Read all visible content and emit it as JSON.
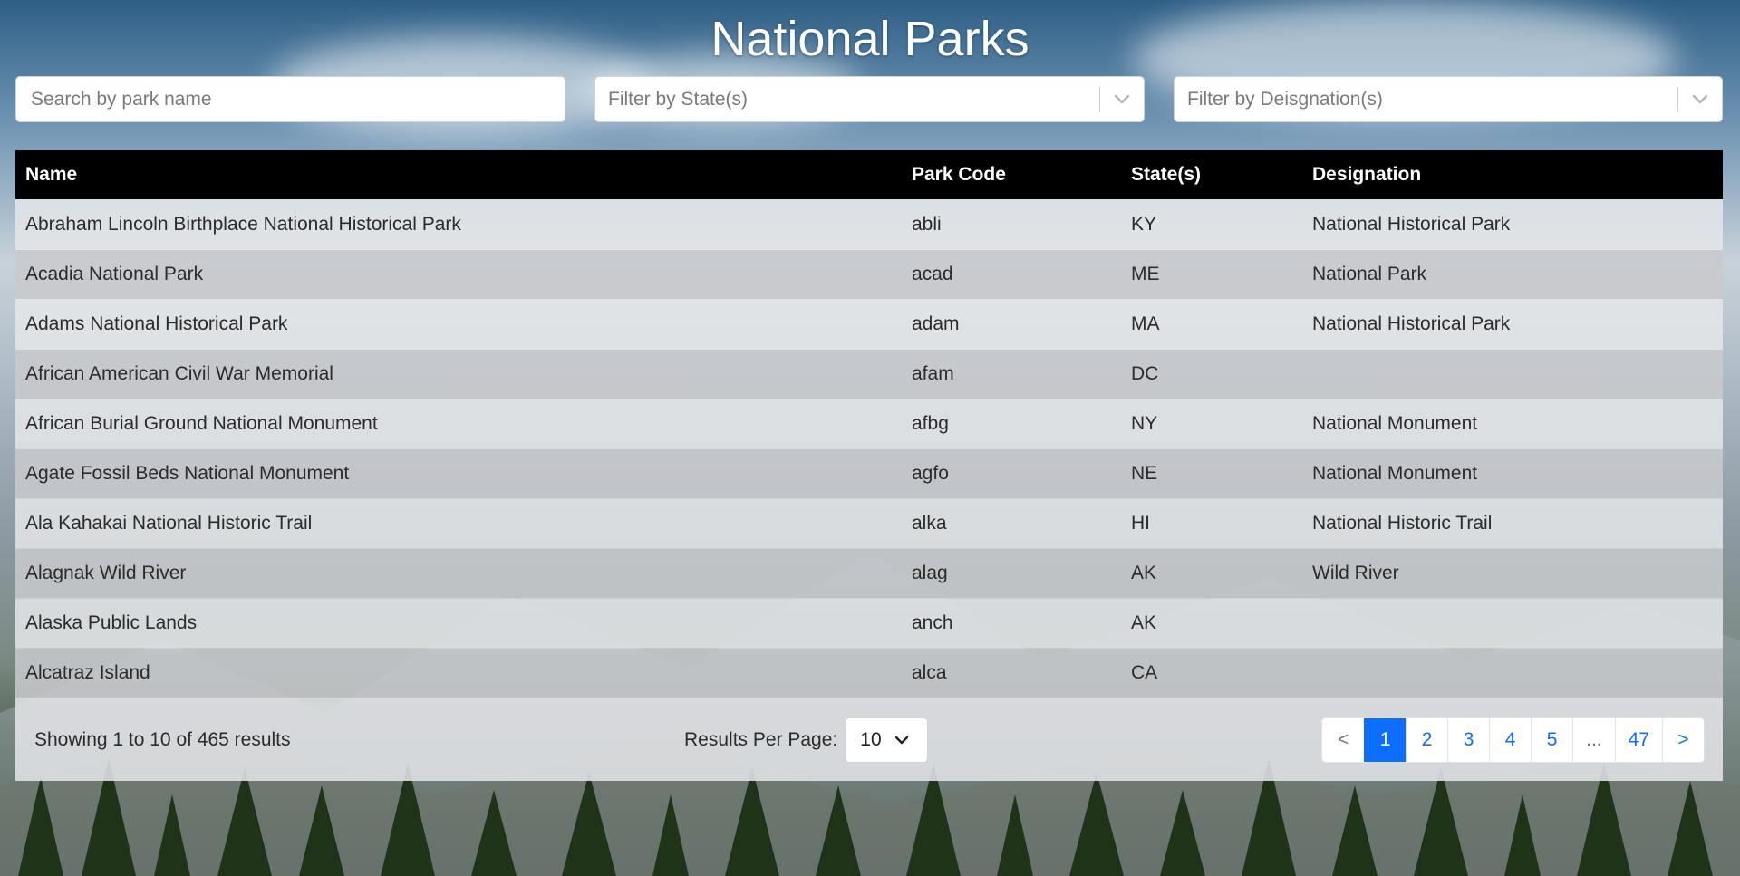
{
  "page": {
    "title": "National Parks"
  },
  "filters": {
    "search_placeholder": "Search by park name",
    "state_placeholder": "Filter by State(s)",
    "designation_placeholder": "Filter by Deisgnation(s)"
  },
  "table": {
    "headers": {
      "name": "Name",
      "park_code": "Park Code",
      "states": "State(s)",
      "designation": "Designation"
    },
    "rows": [
      {
        "name": "Abraham Lincoln Birthplace National Historical Park",
        "code": "abli",
        "states": "KY",
        "designation": "National Historical Park"
      },
      {
        "name": "Acadia National Park",
        "code": "acad",
        "states": "ME",
        "designation": "National Park"
      },
      {
        "name": "Adams National Historical Park",
        "code": "adam",
        "states": "MA",
        "designation": "National Historical Park"
      },
      {
        "name": "African American Civil War Memorial",
        "code": "afam",
        "states": "DC",
        "designation": ""
      },
      {
        "name": "African Burial Ground National Monument",
        "code": "afbg",
        "states": "NY",
        "designation": "National Monument"
      },
      {
        "name": "Agate Fossil Beds National Monument",
        "code": "agfo",
        "states": "NE",
        "designation": "National Monument"
      },
      {
        "name": "Ala Kahakai National Historic Trail",
        "code": "alka",
        "states": "HI",
        "designation": "National Historic Trail"
      },
      {
        "name": "Alagnak Wild River",
        "code": "alag",
        "states": "AK",
        "designation": "Wild River"
      },
      {
        "name": "Alaska Public Lands",
        "code": "anch",
        "states": "AK",
        "designation": ""
      },
      {
        "name": "Alcatraz Island",
        "code": "alca",
        "states": "CA",
        "designation": ""
      }
    ]
  },
  "footer": {
    "showing_text": "Showing 1 to 10 of 465 results",
    "results_per_page_label": "Results Per Page:",
    "results_per_page_value": "10"
  },
  "pagination": {
    "prev": "<",
    "pages": [
      "1",
      "2",
      "3",
      "4",
      "5",
      "...",
      "47"
    ],
    "next": ">",
    "active_page": "1"
  },
  "colors": {
    "header_bg": "#000000",
    "accent": "#0d6efd"
  },
  "icons": {
    "dropdown": "chevron-down-icon"
  }
}
